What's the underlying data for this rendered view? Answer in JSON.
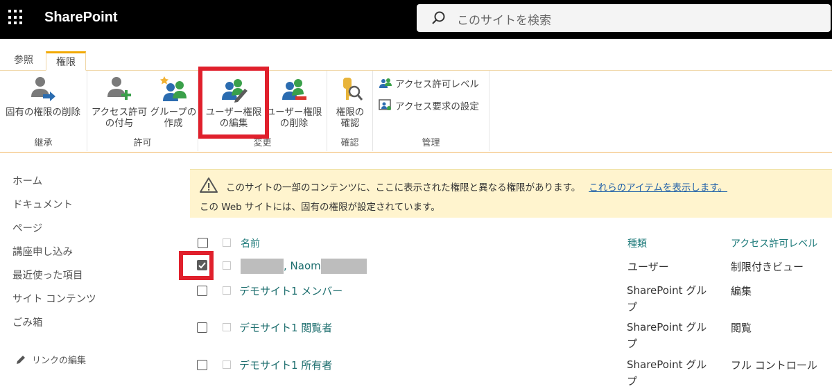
{
  "suitebar": {
    "app_name": "SharePoint",
    "search_placeholder": "このサイトを検索"
  },
  "tabs": [
    {
      "label": "参照"
    },
    {
      "label": "権限"
    }
  ],
  "ribbon": {
    "groups": [
      {
        "label": "継承",
        "buttons": [
          {
            "label_1": "固有の権限の削除",
            "label_2": ""
          }
        ]
      },
      {
        "label": "許可",
        "buttons": [
          {
            "label_1": "アクセス許可",
            "label_2": "の付与"
          },
          {
            "label_1": "グループの",
            "label_2": "作成"
          }
        ]
      },
      {
        "label": "変更",
        "buttons": [
          {
            "label_1": "ユーザー権限",
            "label_2": "の編集"
          },
          {
            "label_1": "ユーザー権限",
            "label_2": "の削除"
          }
        ]
      },
      {
        "label": "確認",
        "buttons": [
          {
            "label_1": "権限の",
            "label_2": "確認"
          }
        ]
      },
      {
        "label": "管理",
        "buttons": [
          {
            "label_1": "アクセス許可レベル"
          },
          {
            "label_1": "アクセス要求の設定"
          }
        ]
      }
    ]
  },
  "leftnav": {
    "items": [
      "ホーム",
      "ドキュメント",
      "ページ",
      "講座申し込み",
      "最近使った項目",
      "サイト コンテンツ",
      "ごみ箱"
    ],
    "edit_links": "リンクの編集"
  },
  "warning": {
    "line1": "このサイトの一部のコンテンツに、ここに表示された権限と異なる権限があります。",
    "link": "これらのアイテムを表示します。",
    "line2": "この Web サイトには、固有の権限が設定されています。"
  },
  "list": {
    "headers": {
      "name": "名前",
      "type": "種類",
      "level": "アクセス許可レベル"
    },
    "rows": [
      {
        "name": ", Naom",
        "type": "ユーザー",
        "level": "制限付きビュー",
        "checked": true
      },
      {
        "name": "デモサイト1 メンバー",
        "type_1": "SharePoint グル",
        "type_2": "プ",
        "level": "編集",
        "checked": false
      },
      {
        "name": "デモサイト1 閲覧者",
        "type_1": "SharePoint グル",
        "type_2": "プ",
        "level": "閲覧",
        "checked": false
      },
      {
        "name": "デモサイト1 所有者",
        "type_1": "SharePoint グル",
        "type_2": "プ",
        "level": "フル コントロール",
        "checked": false
      }
    ]
  },
  "colors": {
    "suitebar": "#000000",
    "highlight": "#e0202c",
    "link": "#1d6e6e",
    "warning_bg": "#fff4ce"
  }
}
